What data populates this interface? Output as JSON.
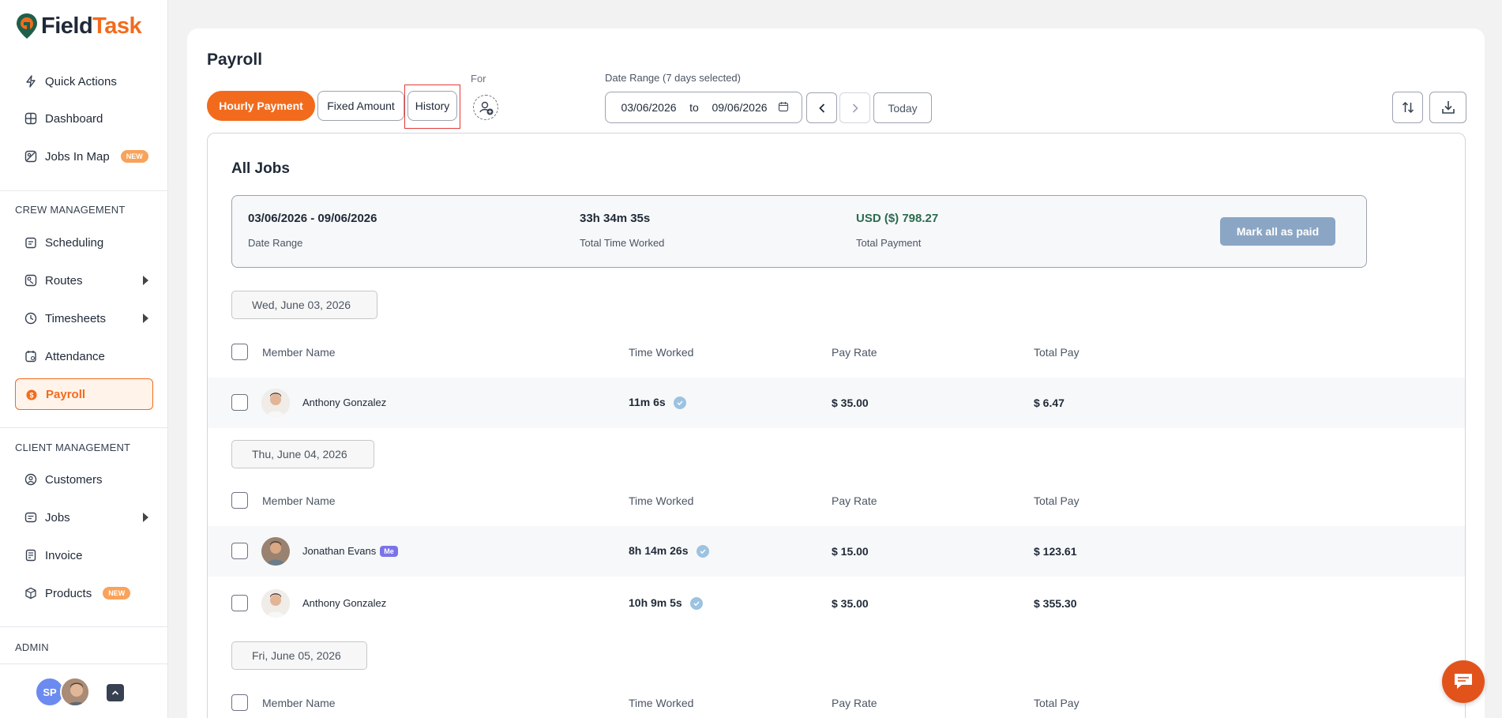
{
  "app": {
    "logo_part1": "Field",
    "logo_part2": "Task",
    "accent_color": "#f26b1d"
  },
  "sidebar": {
    "top_items": [
      {
        "label": "Quick Actions",
        "icon": "lightning-icon"
      },
      {
        "label": "Dashboard",
        "icon": "dashboard-icon"
      },
      {
        "label": "Jobs In Map",
        "icon": "map-icon",
        "badge": "NEW"
      }
    ],
    "crew_section": "CREW MANAGEMENT",
    "crew_items": [
      {
        "label": "Scheduling",
        "icon": "calendar-icon"
      },
      {
        "label": "Routes",
        "icon": "routes-icon"
      },
      {
        "label": "Timesheets",
        "icon": "clock-icon"
      },
      {
        "label": "Attendance",
        "icon": "attendance-icon"
      },
      {
        "label": "Payroll",
        "icon": "payroll-icon"
      }
    ],
    "client_section": "CLIENT MANAGEMENT",
    "client_items": [
      {
        "label": "Customers",
        "icon": "customer-icon"
      },
      {
        "label": "Jobs",
        "icon": "jobs-icon"
      },
      {
        "label": "Invoice",
        "icon": "invoice-icon"
      },
      {
        "label": "Products",
        "icon": "box-icon",
        "badge": "NEW"
      }
    ],
    "admin_section": "ADMIN",
    "user_initials": "SP"
  },
  "header": {
    "title": "Payroll",
    "tabs": {
      "hourly": "Hourly Payment",
      "fixed": "Fixed Amount",
      "history": "History"
    },
    "for_label": "For",
    "date_range_label": "Date Range (7 days selected)",
    "date_from": "03/06/2026",
    "date_to_word": "to",
    "date_to": "09/06/2026",
    "today": "Today"
  },
  "panel": {
    "title": "All Jobs",
    "summary": {
      "date_range": "03/06/2026 - 09/06/2026",
      "date_range_label": "Date Range",
      "total_time": "33h 34m 35s",
      "total_time_label": "Total Time Worked",
      "total_payment": "USD ($) 798.27",
      "total_payment_label": "Total Payment",
      "mark_all": "Mark all as paid"
    },
    "columns": {
      "member": "Member Name",
      "time": "Time Worked",
      "rate": "Pay Rate",
      "total": "Total Pay"
    },
    "days": [
      {
        "date": "Wed, June 03, 2026",
        "rows": [
          {
            "name": "Anthony Gonzalez",
            "time": "11m 6s",
            "rate": "$ 35.00",
            "total": "$ 6.47"
          }
        ]
      },
      {
        "date": "Thu, June 04, 2026",
        "rows": [
          {
            "name": "Jonathan Evans",
            "badge": "Me",
            "time": "8h 14m 26s",
            "rate": "$ 15.00",
            "total": "$ 123.61"
          },
          {
            "name": "Anthony Gonzalez",
            "time": "10h 9m 5s",
            "rate": "$ 35.00",
            "total": "$ 355.30"
          }
        ]
      },
      {
        "date": "Fri, June 05, 2026",
        "rows": []
      }
    ]
  }
}
